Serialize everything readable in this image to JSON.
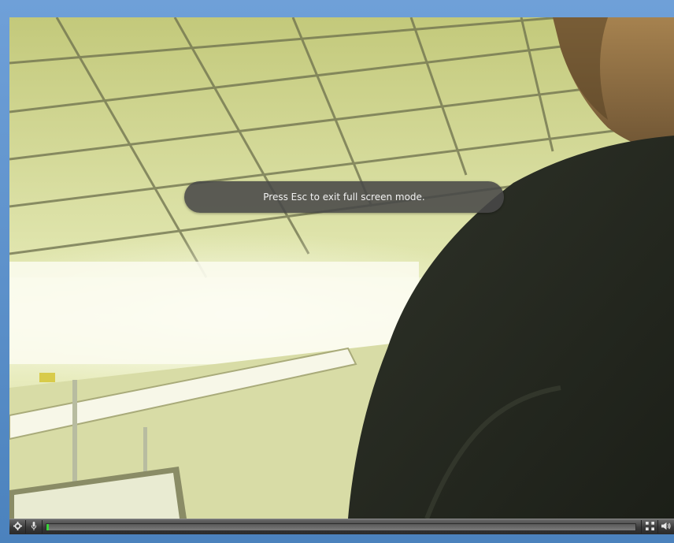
{
  "overlay": {
    "message": "Press Esc to exit full screen mode."
  },
  "controls": {
    "progress": 0.002,
    "icons": [
      "settings-icon",
      "microphone-icon",
      "fullscreen-icon",
      "volume-icon"
    ]
  },
  "colors": {
    "window_frame": "#4f86bf",
    "toast_bg": "#484848",
    "controlbar_bg": "#3a3a3a",
    "progress_fill": "#3bd33b"
  }
}
